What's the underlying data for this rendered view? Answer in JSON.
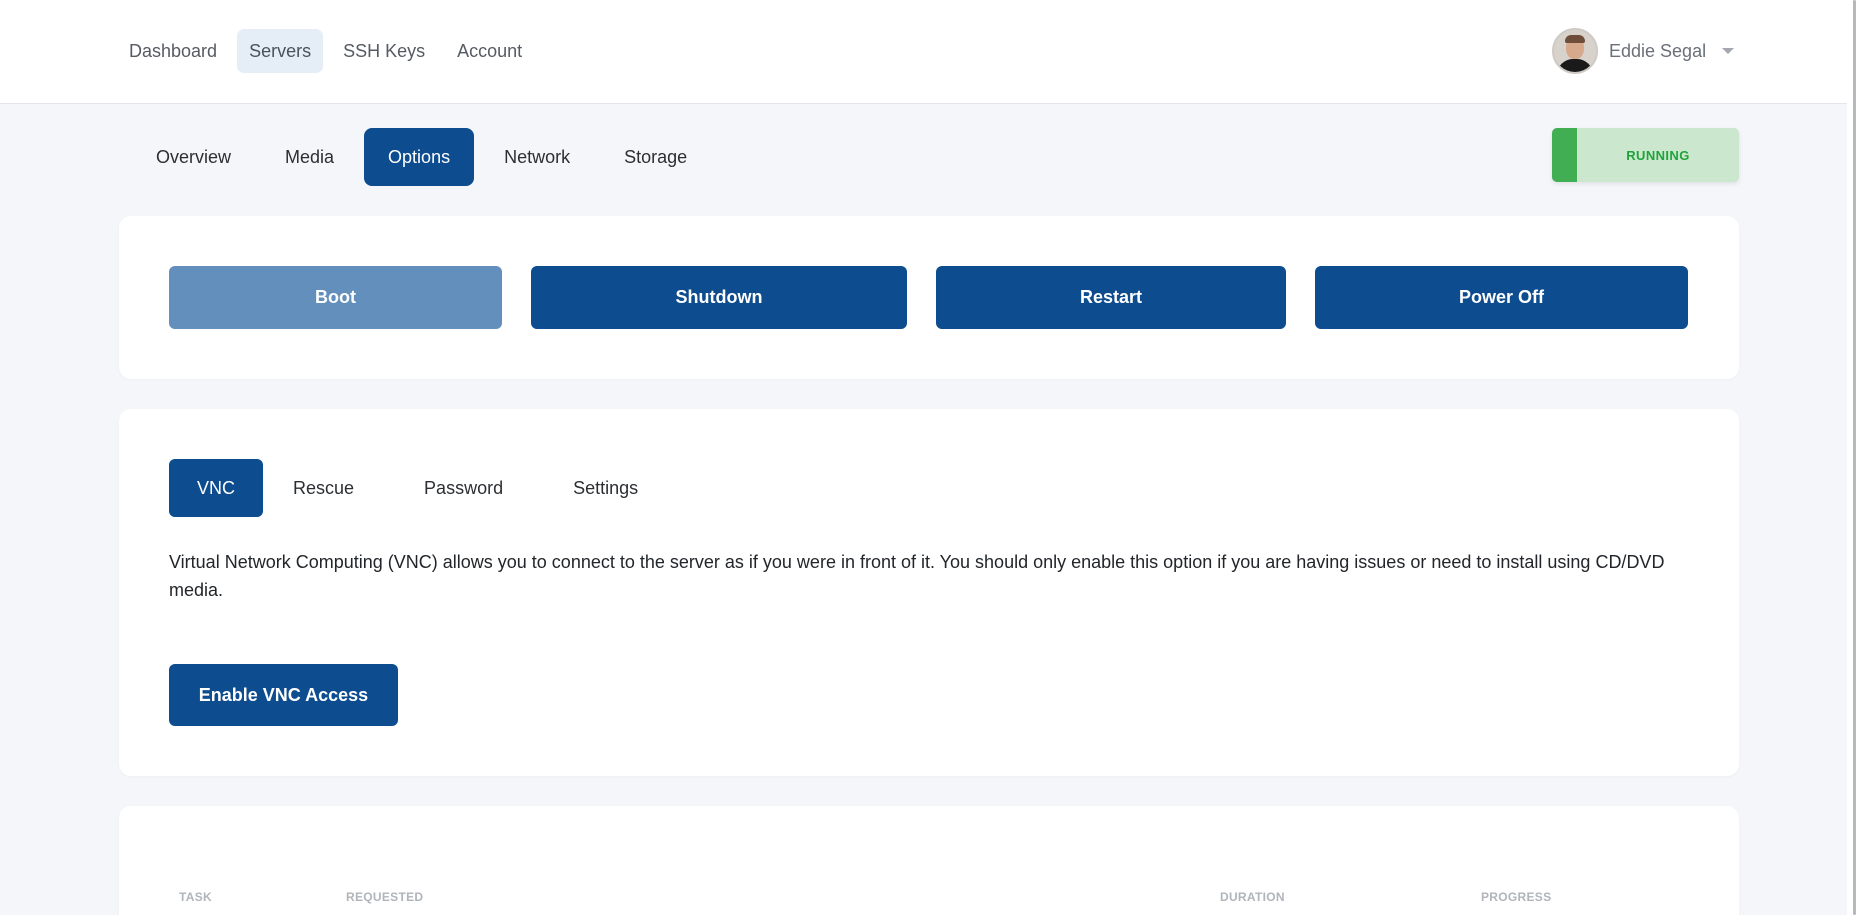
{
  "nav": {
    "items": [
      {
        "label": "Dashboard",
        "active": false
      },
      {
        "label": "Servers",
        "active": true
      },
      {
        "label": "SSH Keys",
        "active": false
      },
      {
        "label": "Account",
        "active": false
      }
    ],
    "user": {
      "name": "Eddie Segal",
      "avatar_icon": "user-avatar-photo"
    }
  },
  "server_tabs": [
    {
      "label": "Overview",
      "active": false
    },
    {
      "label": "Media",
      "active": false
    },
    {
      "label": "Options",
      "active": true
    },
    {
      "label": "Network",
      "active": false
    },
    {
      "label": "Storage",
      "active": false
    }
  ],
  "status": {
    "label": "RUNNING",
    "color": "#41ae53"
  },
  "power_actions": [
    {
      "label": "Boot",
      "disabled": true
    },
    {
      "label": "Shutdown",
      "disabled": false
    },
    {
      "label": "Restart",
      "disabled": false
    },
    {
      "label": "Power Off",
      "disabled": false
    }
  ],
  "option_tabs": [
    {
      "label": "VNC",
      "active": true
    },
    {
      "label": "Rescue",
      "active": false
    },
    {
      "label": "Password",
      "active": false
    },
    {
      "label": "Settings",
      "active": false
    }
  ],
  "vnc": {
    "description": "Virtual Network Computing (VNC) allows you to connect to the server as if you were in front of it. You should only enable this option if you are having issues or need to install using CD/DVD media.",
    "enable_label": "Enable VNC Access"
  },
  "tasks": {
    "columns": [
      "TASK",
      "REQUESTED",
      "DURATION",
      "PROGRESS"
    ]
  },
  "colors": {
    "primary": "#0d4c8f",
    "primary_disabled": "#628fbc",
    "running_bg": "#cbe7ce",
    "running_text": "#1fa43a",
    "page_bg": "#f4f6fa"
  }
}
